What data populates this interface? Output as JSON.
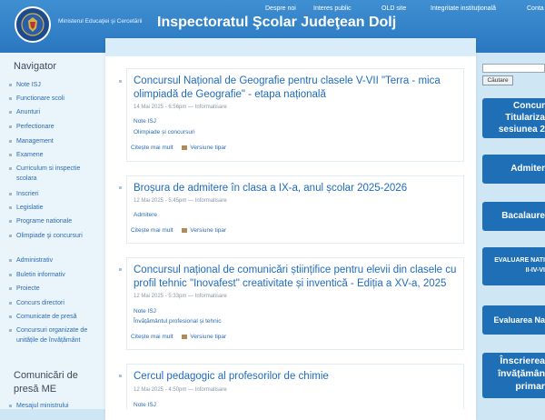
{
  "header": {
    "ministry": "Ministerul Educaţiei şi Cercetării",
    "title": "Inspectoratul Şcolar Judeţean Dolj",
    "nav": [
      "Despre noi",
      "Interes public",
      "OLD site",
      "Integritate instituţională",
      "Conta"
    ]
  },
  "sidebar": {
    "title": "Navigator",
    "items": [
      "Note ISJ",
      "Functionare scoli",
      "Anunturi",
      "Perfectionare",
      "Management",
      "Examene",
      "Curriculum si inspectie scolara",
      "Inscrieri",
      "Legislatie",
      "Programe nationale",
      "Olimpiade şi concursuri",
      "Administrativ",
      "Buletin informativ",
      "Proiecte",
      "Concurs directori",
      "Comunicate de presă",
      "Concursuri organizate de unitățile de învățământ"
    ],
    "press_title": "Comunicări de presă ME",
    "press_items": [
      "Mesajul ministrului"
    ]
  },
  "articles": [
    {
      "title": "Concursul Național de Geografie pentru clasele V-VII \"Terra - mica olimpiadă de Geografie\" - etapa națională",
      "meta": "14 Mai 2025 - 6:56pm — Informatisare",
      "tags": [
        "Note ISJ",
        "Olimpiade și concursuri"
      ],
      "read_more": "Citește mai mult",
      "print": "Versiune tipar"
    },
    {
      "title": "Broșura de admitere în clasa a IX-a, anul școlar 2025-2026",
      "meta": "12 Mai 2025 - 5:45pm — Informatisare",
      "tags": [
        "Admitere"
      ],
      "read_more": "Citește mai mult",
      "print": "Versiune tipar"
    },
    {
      "title": "Concursul național de comunicări științifice pentru elevii din clasele cu profil tehnic \"Inovafest\" creativitate și inventică - Ediția a XV-a, 2025",
      "meta": "12 Mai 2025 - 5:33pm — Informatisare",
      "tags": [
        "Note ISJ",
        "Învățământul profesional și tehnic"
      ],
      "read_more": "Citește mai mult",
      "print": "Versiune tipar"
    },
    {
      "title": "Cercul pedagogic al profesorilor de chimie",
      "meta": "12 Mai 2025 - 4:50pm — Informatisare",
      "tags": [
        "Note ISJ"
      ],
      "read_more": "",
      "print": ""
    }
  ],
  "search": {
    "value": "",
    "button": "Căutare"
  },
  "banners": [
    [
      "Concur",
      "Titulariza",
      "sesiunea 2"
    ],
    [
      "Admiter"
    ],
    [
      "Bacalaure"
    ],
    [
      "EVALUARE NATI",
      "II-IV-VI"
    ],
    [
      "Evaluarea Na"
    ],
    [
      "Înscrierea",
      "învățămân",
      "primar"
    ]
  ],
  "colors": {
    "header": "#2a77c0",
    "link": "#1f6bbf",
    "banner": "#1f6fb7",
    "background": "#cfe6f5"
  }
}
